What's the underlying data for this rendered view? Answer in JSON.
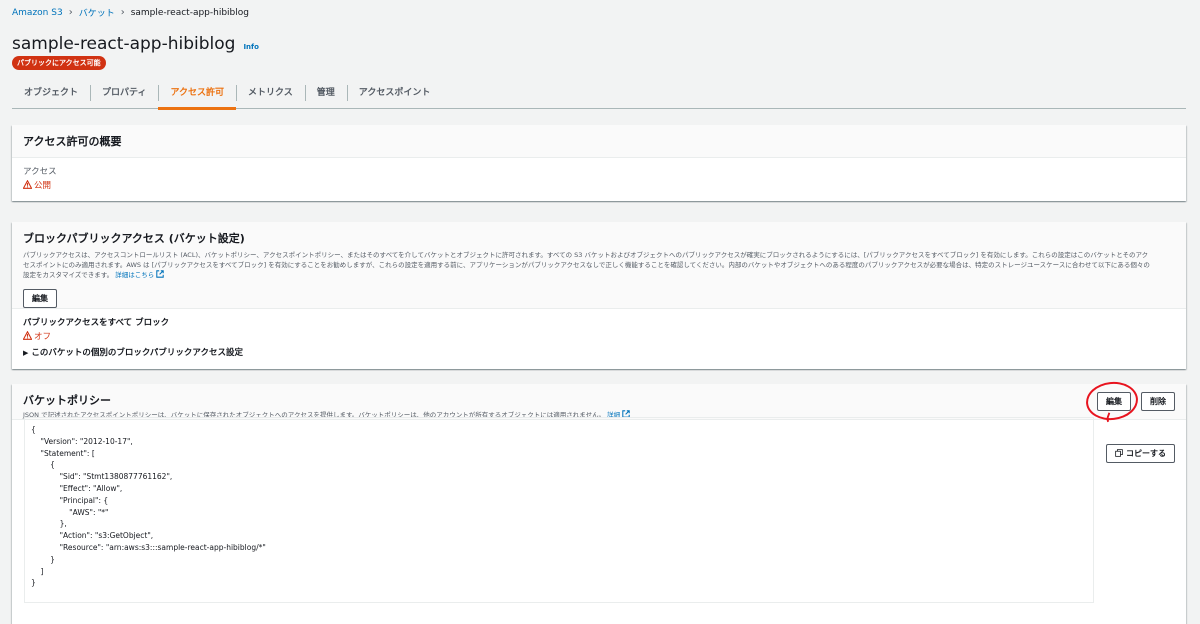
{
  "breadcrumb": {
    "root": "Amazon S3",
    "buckets": "バケット",
    "current": "sample-react-app-hibiblog"
  },
  "header": {
    "title": "sample-react-app-hibiblog",
    "info": "Info",
    "badge": "パブリックにアクセス可能"
  },
  "tabs": [
    {
      "label": "オブジェクト"
    },
    {
      "label": "プロパティ"
    },
    {
      "label": "アクセス許可"
    },
    {
      "label": "メトリクス"
    },
    {
      "label": "管理"
    },
    {
      "label": "アクセスポイント"
    }
  ],
  "active_tab": "アクセス許可",
  "overview": {
    "title": "アクセス許可の概要",
    "access_label": "アクセス",
    "access_value": "公開"
  },
  "block_public": {
    "title": "ブロックパブリックアクセス (バケット設定)",
    "description_1": "パブリックアクセスは、アクセスコントロールリスト (ACL)、バケットポリシー、アクセスポイントポリシー、またはそのすべてを介してバケットとオブジェクトに許可されます。すべての S3 バケットおよびオブジェクトへのパブリックアクセスが確実にブロックされるようにするには、[パブリックアクセスをすべてブロック] を有効にします。これらの設定はこのバケットとそのアク",
    "description_2": "セスポイントにのみ適用されます。AWS は [パブリックアクセスをすべてブロック] を有効にすることをお勧めしますが、これらの設定を適用する前に、アプリケーションがパブリックアクセスなしで正しく機能することを確認してください。内部のバケットやオブジェクトへのある程度のパブリックアクセスが必要な場合は、特定のストレージユースケースに合わせて以下にある個々の",
    "description_3": "設定をカスタマイズできます。",
    "learn_more": "詳細はこちら",
    "edit_button": "編集",
    "block_all_label": "パブリックアクセスをすべて ブロック",
    "block_all_value": "オフ",
    "individual_settings": "このバケットの個別のブロックパブリックアクセス設定"
  },
  "policy": {
    "title": "バケットポリシー",
    "description": "JSON で記述されたアクセスポイントポリシーは、バケットに保存されたオブジェクトへのアクセスを提供します。バケットポリシーは、他のアカウントが所有するオブジェクトには適用されません。",
    "learn_more": "詳細",
    "edit_button": "編集",
    "delete_button": "削除",
    "copy_button": "コピーする",
    "json_lines": [
      "{",
      "    \"Version\": \"2012-10-17\",",
      "    \"Statement\": [",
      "        {",
      "            \"Sid\": \"Stmt1380877761162\",",
      "            \"Effect\": \"Allow\",",
      "            \"Principal\": {",
      "                \"AWS\": \"*\"",
      "            },",
      "            \"Action\": \"s3:GetObject\",",
      "            \"Resource\": \"arn:aws:s3:::sample-react-app-hibiblog/*\"",
      "        }",
      "    ]",
      "}"
    ]
  },
  "colors": {
    "accent": "#ec7211",
    "link": "#0073bb",
    "danger": "#d13212",
    "annotation": "#e8141f"
  }
}
